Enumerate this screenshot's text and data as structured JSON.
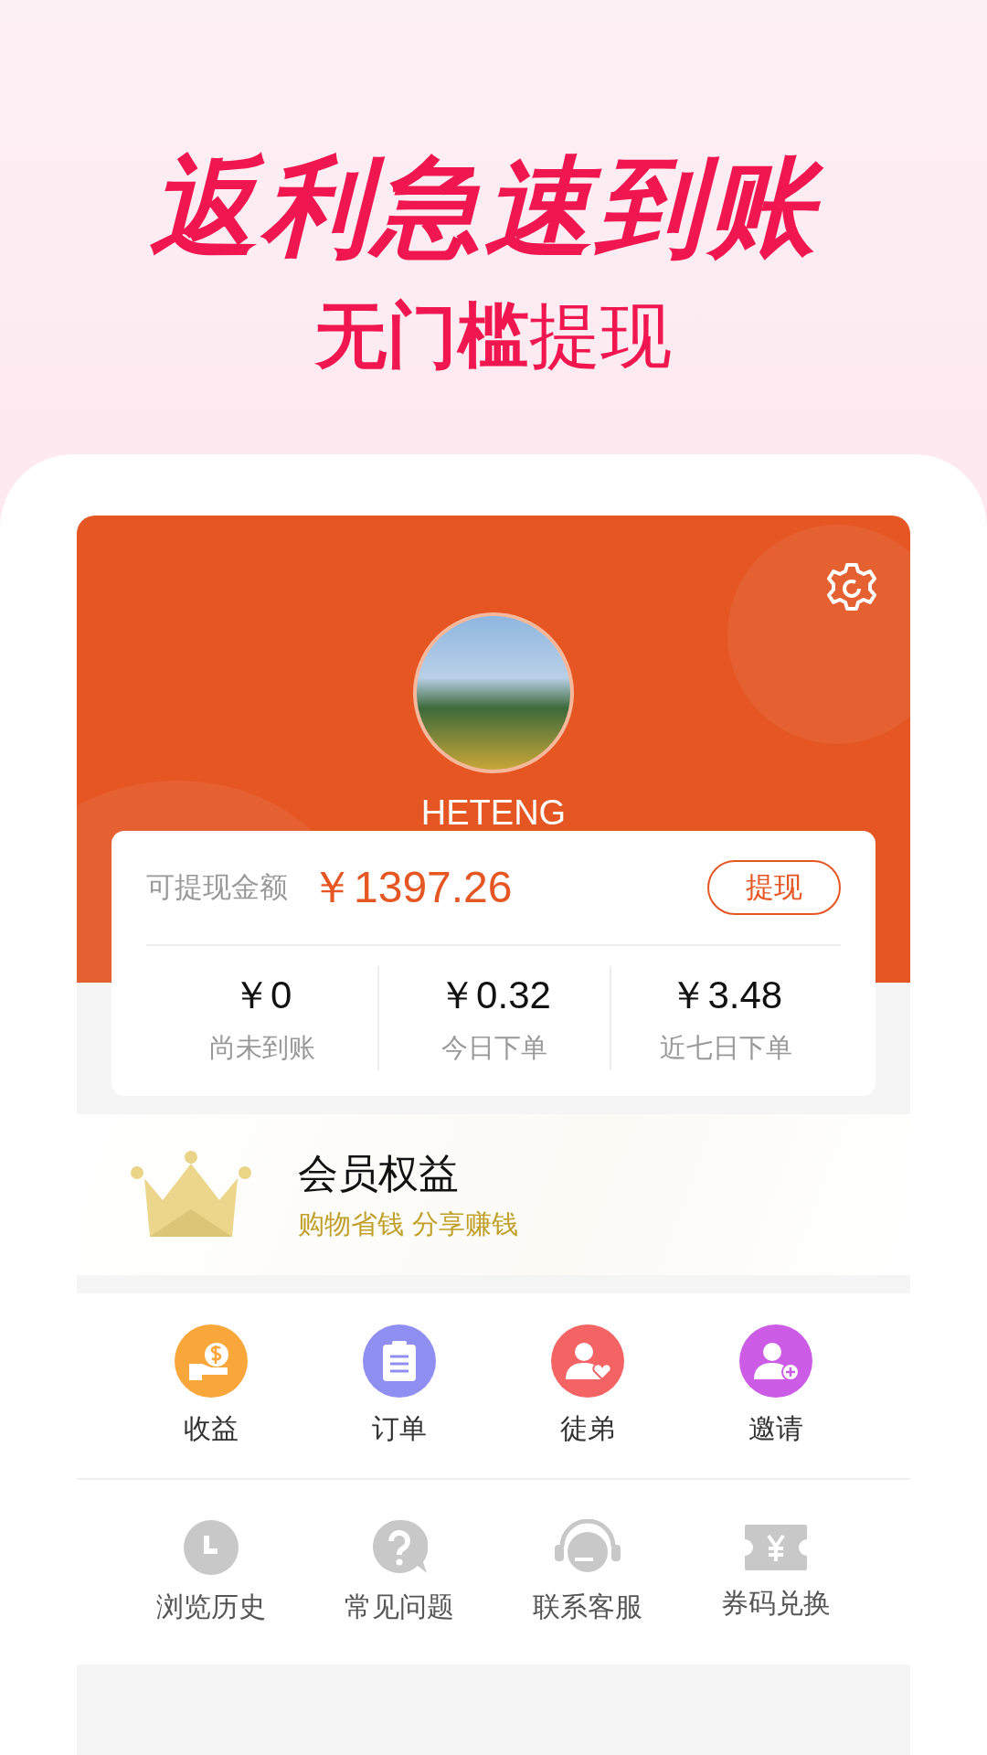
{
  "promo": {
    "headline": "返利急速到账",
    "subheadline": "**无门槛**提现"
  },
  "profile": {
    "name": "HETENG"
  },
  "balance": {
    "label": "可提现金额",
    "amount": "￥1397.26",
    "button": "提现"
  },
  "stats": [
    {
      "value": "￥0",
      "label": "尚未到账"
    },
    {
      "value": "￥0.32",
      "label": "今日下单"
    },
    {
      "value": "￥3.48",
      "label": "近七日下单"
    }
  ],
  "member": {
    "title": "会员权益",
    "subtitle": "购物省钱 分享赚钱"
  },
  "primary_menu": [
    {
      "kind": "income",
      "label": "收益",
      "color": "#f9a63b"
    },
    {
      "kind": "orders",
      "label": "订单",
      "color": "#8f8ff2"
    },
    {
      "kind": "followers",
      "label": "徒弟",
      "color": "#f46464"
    },
    {
      "kind": "invite",
      "label": "邀请",
      "color": "#cc5ce6"
    }
  ],
  "secondary_menu": [
    {
      "kind": "history",
      "label": "浏览历史"
    },
    {
      "kind": "faq",
      "label": "常见问题"
    },
    {
      "kind": "support",
      "label": "联系客服"
    },
    {
      "kind": "coupon",
      "label": "券码兑换"
    }
  ]
}
